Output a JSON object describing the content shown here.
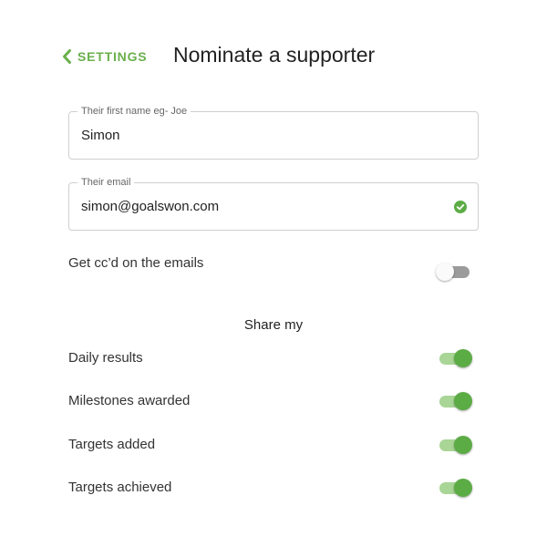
{
  "header": {
    "back_label": "SETTINGS",
    "title": "Nominate a supporter"
  },
  "form": {
    "first_name": {
      "legend": "Their first name eg- Joe",
      "value": "Simon"
    },
    "email": {
      "legend": "Their email",
      "value": "simon@goalswon.com",
      "valid_icon": "check-circle-icon"
    }
  },
  "cc_option": {
    "label": "Get cc’d on the emails",
    "enabled": false
  },
  "share": {
    "heading": "Share my",
    "items": [
      {
        "label": "Daily results",
        "enabled": true
      },
      {
        "label": "Milestones awarded",
        "enabled": true
      },
      {
        "label": "Targets added",
        "enabled": true
      },
      {
        "label": "Targets achieved",
        "enabled": true
      }
    ]
  },
  "colors": {
    "accent": "#6ab04c",
    "toggle_on_thumb": "#5cac46",
    "toggle_on_track": "#a9d596",
    "toggle_off_track": "#9b9b9b"
  }
}
